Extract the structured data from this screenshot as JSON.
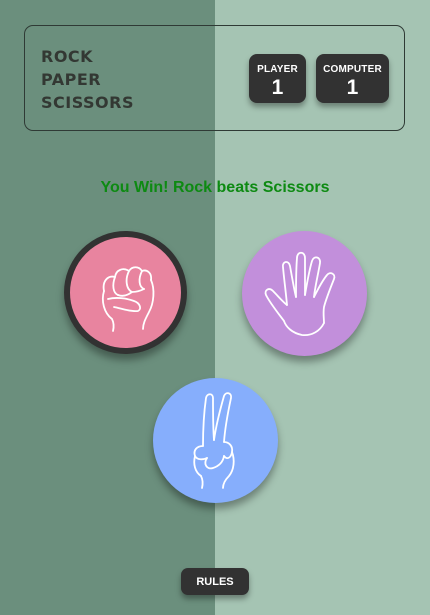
{
  "header": {
    "title_lines": [
      "ROCK",
      "PAPER",
      "SCISSORS"
    ]
  },
  "scores": {
    "player": {
      "label": "PLAYER",
      "value": "1"
    },
    "computer": {
      "label": "COMPUTER",
      "value": "1"
    }
  },
  "result_text": "You Win! Rock beats Scissors",
  "choices": [
    {
      "id": "rock",
      "color": "#e8849f",
      "selected": true,
      "icon": "fist-icon"
    },
    {
      "id": "paper",
      "color": "#c28fdb",
      "selected": false,
      "icon": "open-hand-icon"
    },
    {
      "id": "scissors",
      "color": "#86aefc",
      "selected": false,
      "icon": "peace-hand-icon"
    }
  ],
  "rules_button": {
    "label": "RULES"
  },
  "colors": {
    "background_left": "#6b8f7d",
    "background_right": "#a5c4b3",
    "result_text": "#0d8a12",
    "dark_box": "#323232"
  }
}
